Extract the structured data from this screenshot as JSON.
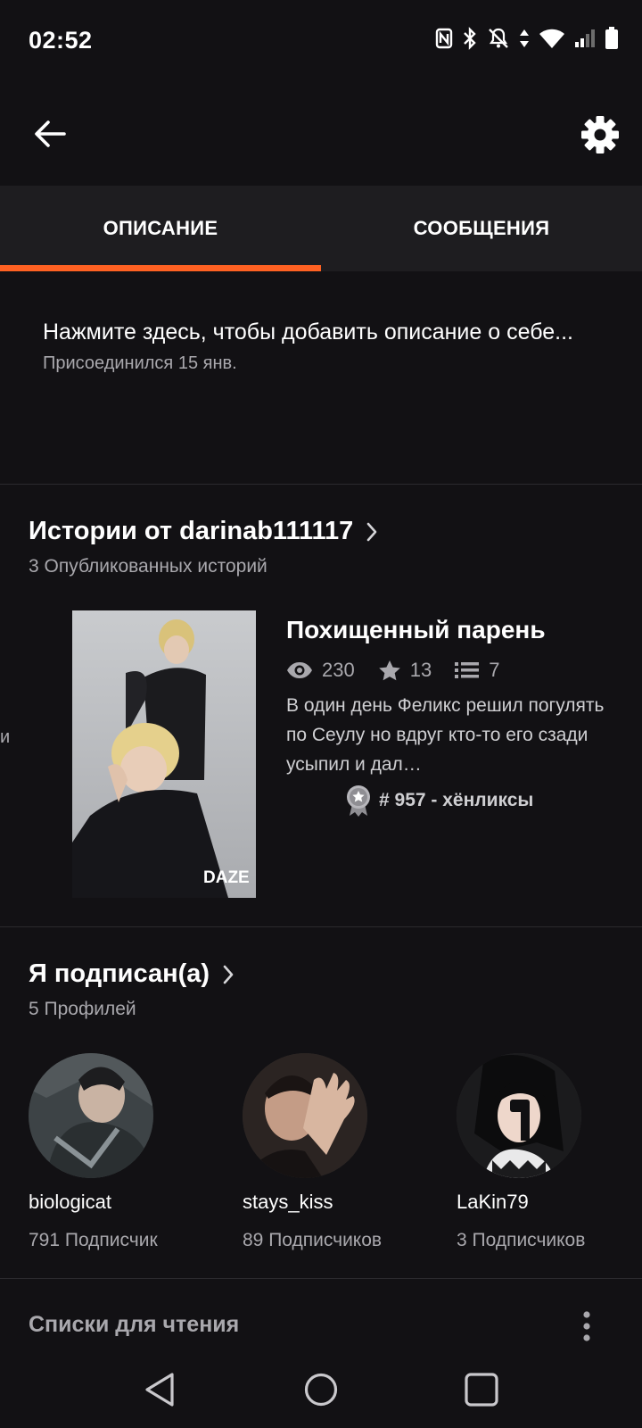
{
  "status_bar": {
    "time": "02:52",
    "icons": [
      "nfc-icon",
      "bluetooth-icon",
      "notifications-off-icon",
      "data-arrows-icon",
      "wifi-icon",
      "signal-icon",
      "battery-icon"
    ]
  },
  "toolbar": {
    "back_icon": "arrow-left-icon",
    "settings_icon": "gear-icon"
  },
  "tabs": [
    {
      "label": "ОПИСАНИЕ",
      "active": true
    },
    {
      "label": "СООБЩЕНИЯ",
      "active": false
    }
  ],
  "accent_color": "#ff6122",
  "about": {
    "prompt": "Нажмите здесь, чтобы добавить описание о себе...",
    "joined": "Присоединился 15 янв."
  },
  "stories_section": {
    "title": "Истории от darinab111117",
    "subtitle": "3 Опубликованных историй",
    "edge_fragment": "и",
    "story": {
      "title": "Похищенный парень",
      "views": "230",
      "votes": "13",
      "parts": "7",
      "description": "В один день Феликс решил погулять по Сеулу но вдруг кто-то его сзади усыпил и дал…",
      "rank": "# 957 - хёнликсы",
      "cover_watermark": "DAZE"
    }
  },
  "following_section": {
    "title": "Я подписан(а)",
    "subtitle": "5 Профилей",
    "profiles": [
      {
        "name": "biologicat",
        "followers": "791 Подписчик"
      },
      {
        "name": "stays_kiss",
        "followers": "89 Подписчиков"
      },
      {
        "name": "LaKin79",
        "followers": "3 Подписчиков"
      }
    ]
  },
  "reading_lists": {
    "title": "Списки для чтения"
  },
  "nav_bar": {
    "icons": [
      "back-triangle-icon",
      "home-circle-icon",
      "recents-square-icon"
    ]
  }
}
